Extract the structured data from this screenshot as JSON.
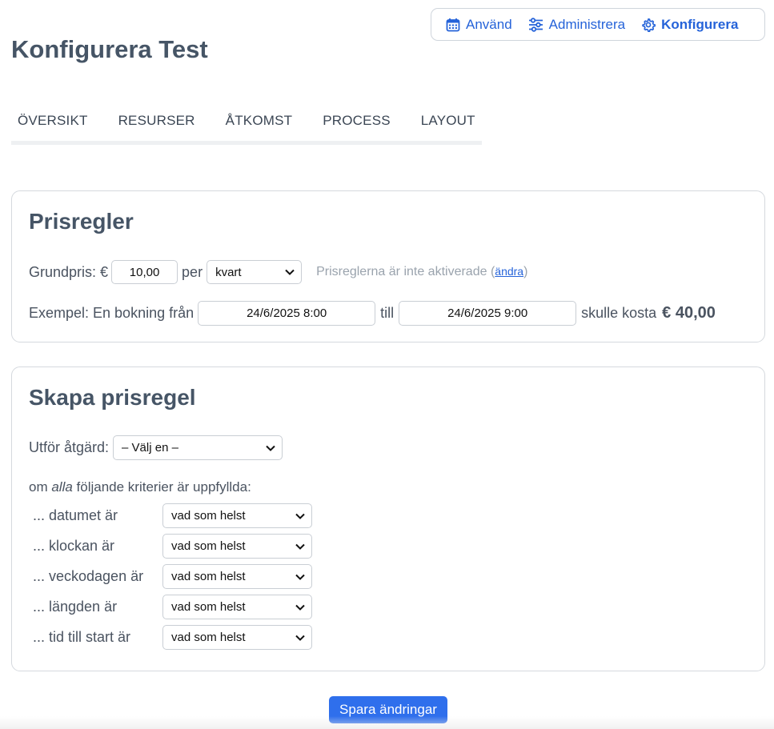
{
  "topnav": {
    "items": [
      {
        "label": "Använd",
        "icon": "calendar-icon"
      },
      {
        "label": "Administrera",
        "icon": "sliders-icon"
      },
      {
        "label": "Konfigurera",
        "icon": "gear-icon",
        "active": true
      }
    ]
  },
  "page": {
    "title": "Konfigurera Test"
  },
  "tabs": [
    {
      "label": "ÖVERSIKT"
    },
    {
      "label": "RESURSER"
    },
    {
      "label": "ÅTKOMST"
    },
    {
      "label": "PROCESS"
    },
    {
      "label": "LAYOUT"
    }
  ],
  "pricing": {
    "title": "Prisregler",
    "base_label": "Grundpris: €",
    "base_value": "10,00",
    "per_label": "per",
    "unit_selected": "kvart",
    "status_text": "Prisreglerna är inte aktiverade (",
    "change_link": "ändra",
    "status_close": ")",
    "example_label": "Exempel: En bokning från",
    "from_value": "24/6/2025 8:00",
    "to_label": "till",
    "to_value": "24/6/2025 9:00",
    "cost_label": "skulle kosta",
    "cost_value": "€ 40,00"
  },
  "create_rule": {
    "title": "Skapa prisregel",
    "action_label": "Utför åtgärd:",
    "action_selected": "– Välj en –",
    "criteria_intro_pre": "om ",
    "criteria_intro_em": "alla",
    "criteria_intro_post": " följande kriterier är uppfyllda:",
    "criteria": [
      {
        "label": "... datumet är",
        "value": "vad som helst"
      },
      {
        "label": "... klockan är",
        "value": "vad som helst"
      },
      {
        "label": "... veckodagen är",
        "value": "vad som helst"
      },
      {
        "label": "... längden är",
        "value": "vad som helst"
      },
      {
        "label": "... tid till start är",
        "value": "vad som helst"
      }
    ]
  },
  "save_button": "Spara ändringar",
  "colors": {
    "accent": "#2563d9",
    "button": "#2f6fec",
    "heading": "#465566",
    "muted": "#9aa3ad"
  }
}
